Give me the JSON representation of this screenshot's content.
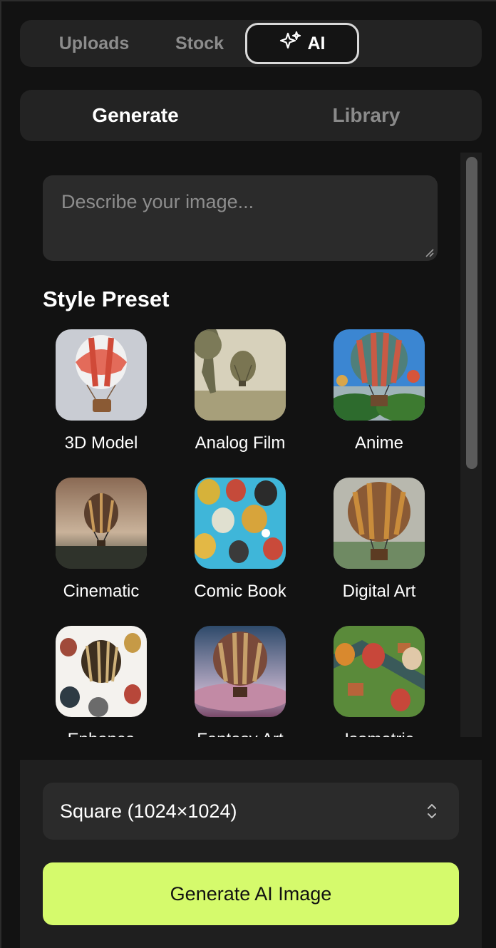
{
  "source_tabs": {
    "uploads": "Uploads",
    "stock": "Stock",
    "ai": "AI",
    "active": "AI"
  },
  "mode_tabs": {
    "generate": "Generate",
    "library": "Library",
    "active": "Generate"
  },
  "prompt": {
    "placeholder": "Describe your image...",
    "value": ""
  },
  "style_preset": {
    "title": "Style Preset",
    "items": [
      {
        "label": "3D Model",
        "icon": "hot-air-balloon-3d-thumbnail"
      },
      {
        "label": "Analog Film",
        "icon": "hot-air-balloon-analog-thumbnail"
      },
      {
        "label": "Anime",
        "icon": "hot-air-balloon-anime-thumbnail"
      },
      {
        "label": "Cinematic",
        "icon": "hot-air-balloon-cinematic-thumbnail"
      },
      {
        "label": "Comic Book",
        "icon": "hot-air-balloon-comic-thumbnail"
      },
      {
        "label": "Digital Art",
        "icon": "hot-air-balloon-digital-thumbnail"
      },
      {
        "label": "Enhance",
        "icon": "hot-air-balloon-enhance-thumbnail"
      },
      {
        "label": "Fantasy Art",
        "icon": "hot-air-balloon-fantasy-thumbnail"
      },
      {
        "label": "Isometric",
        "icon": "hot-air-balloon-isometric-thumbnail"
      }
    ]
  },
  "size_select": {
    "value": "Square (1024×1024)"
  },
  "generate_button": {
    "label": "Generate AI Image"
  },
  "colors": {
    "accent": "#d5fa6c",
    "background": "#121212",
    "surface": "#232323"
  }
}
